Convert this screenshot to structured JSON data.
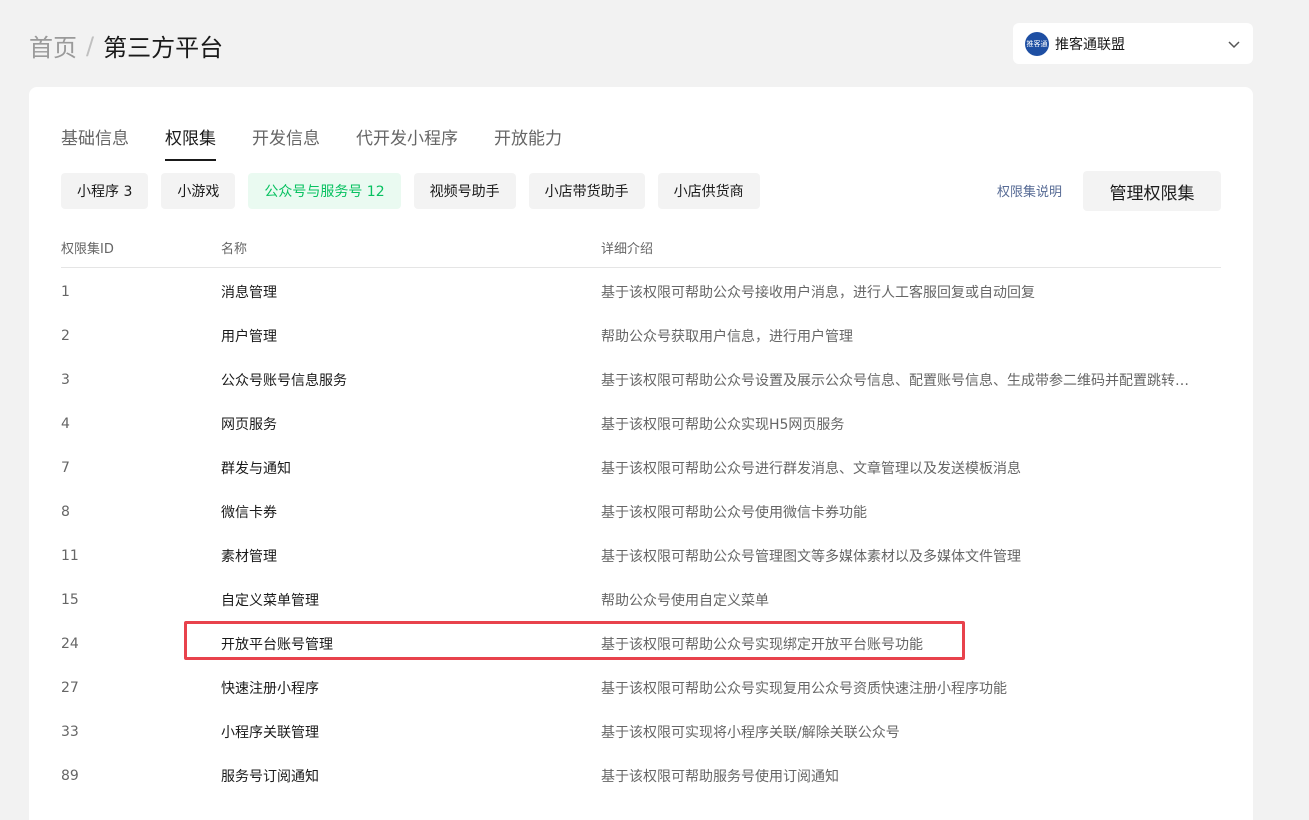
{
  "breadcrumb": {
    "home": "首页",
    "separator": "/",
    "current": "第三方平台"
  },
  "account": {
    "avatar_text": "推客通",
    "name": "推客通联盟",
    "chevron_icon": "chevron-down-icon"
  },
  "tabs": [
    {
      "label": "基础信息",
      "active": false
    },
    {
      "label": "权限集",
      "active": true
    },
    {
      "label": "开发信息",
      "active": false
    },
    {
      "label": "代开发小程序",
      "active": false
    },
    {
      "label": "开放能力",
      "active": false
    }
  ],
  "chips": [
    {
      "label": "小程序 3",
      "active": false
    },
    {
      "label": "小游戏",
      "active": false
    },
    {
      "label": "公众号与服务号 12",
      "active": true
    },
    {
      "label": "视频号助手",
      "active": false
    },
    {
      "label": "小店带货助手",
      "active": false
    },
    {
      "label": "小店供货商",
      "active": false
    }
  ],
  "help_link": "权限集说明",
  "manage_button": "管理权限集",
  "table": {
    "headers": {
      "id": "权限集ID",
      "name": "名称",
      "desc": "详细介绍"
    },
    "rows": [
      {
        "id": "1",
        "name": "消息管理",
        "desc": "基于该权限可帮助公众号接收用户消息，进行人工客服回复或自动回复"
      },
      {
        "id": "2",
        "name": "用户管理",
        "desc": "帮助公众号获取用户信息，进行用户管理"
      },
      {
        "id": "3",
        "name": "公众号账号信息服务",
        "desc": "基于该权限可帮助公众号设置及展示公众号信息、配置账号信息、生成带参二维码并配置跳转…"
      },
      {
        "id": "4",
        "name": "网页服务",
        "desc": "基于该权限可帮助公众实现H5网页服务"
      },
      {
        "id": "7",
        "name": "群发与通知",
        "desc": "基于该权限可帮助公众号进行群发消息、文章管理以及发送模板消息"
      },
      {
        "id": "8",
        "name": "微信卡券",
        "desc": "基于该权限可帮助公众号使用微信卡券功能"
      },
      {
        "id": "11",
        "name": "素材管理",
        "desc": "基于该权限可帮助公众号管理图文等多媒体素材以及多媒体文件管理"
      },
      {
        "id": "15",
        "name": "自定义菜单管理",
        "desc": "帮助公众号使用自定义菜单"
      },
      {
        "id": "24",
        "name": "开放平台账号管理",
        "desc": "基于该权限可帮助公众号实现绑定开放平台账号功能"
      },
      {
        "id": "27",
        "name": "快速注册小程序",
        "desc": "基于该权限可帮助公众号实现复用公众号资质快速注册小程序功能"
      },
      {
        "id": "33",
        "name": "小程序关联管理",
        "desc": "基于该权限可实现将小程序关联/解除关联公众号"
      },
      {
        "id": "89",
        "name": "服务号订阅通知",
        "desc": "基于该权限可帮助服务号使用订阅通知"
      }
    ]
  },
  "colors": {
    "accent_green": "#07c160",
    "highlight_red": "#e8424c",
    "link_blue": "#576b95"
  }
}
